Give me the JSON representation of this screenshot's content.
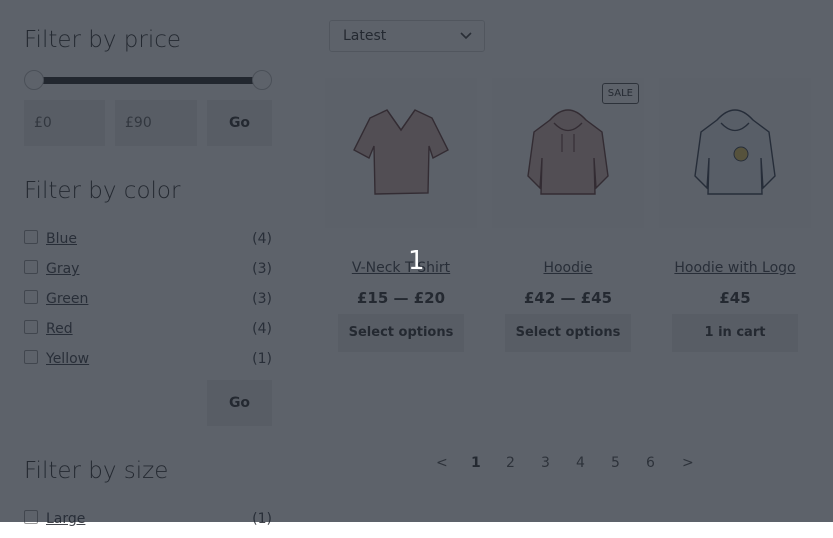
{
  "sidebar": {
    "price_title": "Filter by price",
    "min_price": "£0",
    "max_price": "£90",
    "price_go": "Go",
    "color_title": "Filter by color",
    "colors": [
      {
        "label": "Blue",
        "count": "(4)"
      },
      {
        "label": "Gray",
        "count": "(3)"
      },
      {
        "label": "Green",
        "count": "(3)"
      },
      {
        "label": "Red",
        "count": "(4)"
      },
      {
        "label": "Yellow",
        "count": "(1)"
      }
    ],
    "color_go": "Go",
    "size_title": "Filter by size",
    "sizes": [
      {
        "label": "Large",
        "count": "(1)"
      }
    ]
  },
  "sort": {
    "selected": "Latest"
  },
  "products": [
    {
      "title": "V-Neck T-Shirt",
      "price": "£15 — £20",
      "button": "Select options",
      "sale": ""
    },
    {
      "title": "Hoodie",
      "price": "£42 — £45",
      "button": "Select options",
      "sale": "SALE"
    },
    {
      "title": "Hoodie with Logo",
      "price": "£45",
      "button": "1 in cart",
      "sale": ""
    }
  ],
  "pagination": {
    "prev": "<",
    "pages": [
      "1",
      "2",
      "3",
      "4",
      "5",
      "6"
    ],
    "next": ">"
  },
  "overlay": {
    "marker": "1"
  }
}
